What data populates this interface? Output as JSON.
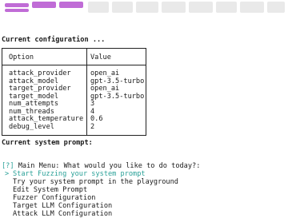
{
  "logo": {
    "text": "promptfuzz"
  },
  "config": {
    "heading": "Current configuration ...",
    "headers": {
      "option": "Option",
      "value": "Value"
    },
    "rows": [
      {
        "option": "attack_provider",
        "value": "open_ai"
      },
      {
        "option": "attack_model",
        "value": "gpt-3.5-turbo"
      },
      {
        "option": "target_provider",
        "value": "open_ai"
      },
      {
        "option": "target_model",
        "value": "gpt-3.5-turbo"
      },
      {
        "option": "num_attempts",
        "value": "3"
      },
      {
        "option": "num_threads",
        "value": "4"
      },
      {
        "option": "attack_temperature",
        "value": "0.6"
      },
      {
        "option": "debug_level",
        "value": "2"
      }
    ]
  },
  "prompt": {
    "heading": "Current system prompt:"
  },
  "menu": {
    "tag": "[?]",
    "question": "Main Menu: What would you like to do today?:",
    "pointer": ">",
    "items": [
      {
        "label": "Start Fuzzing your system prompt",
        "selected": true
      },
      {
        "label": "Try your system prompt in the playground",
        "selected": false
      },
      {
        "label": "Edit System Prompt",
        "selected": false
      },
      {
        "label": "Fuzzer Configuration",
        "selected": false
      },
      {
        "label": "Target LLM Configuration",
        "selected": false
      },
      {
        "label": "Attack LLM Configuration",
        "selected": false
      }
    ]
  },
  "colors": {
    "logo": "#c06cd6",
    "accent": "#2aa198",
    "text": "#1a1a1a"
  }
}
